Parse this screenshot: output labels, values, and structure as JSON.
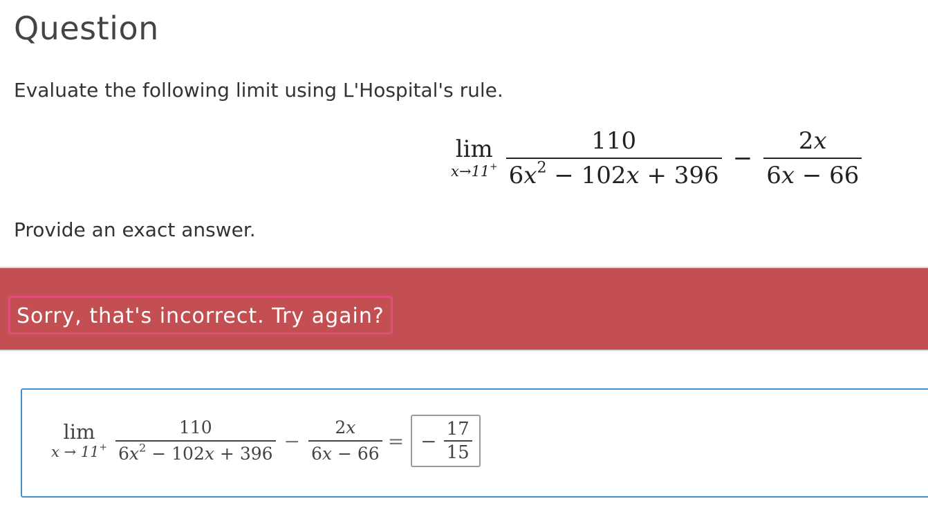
{
  "heading": "Question",
  "instructions": "Evaluate the following limit using L'Hospital's rule.",
  "formula": {
    "lim": "lim",
    "limit_sub": "x→11",
    "limit_sup": "+",
    "frac1_num": "110",
    "frac1_den": {
      "coef": "6",
      "var": "x",
      "exp": "2",
      "rest": " − 102",
      "var2": "x",
      "tail": " + 396"
    },
    "minus": "−",
    "frac2_num": {
      "coef": "2",
      "var": "x"
    },
    "frac2_den": {
      "coef": "6",
      "var": "x",
      "tail": " − 66"
    }
  },
  "note": "Provide an exact answer.",
  "feedback": {
    "message": "Sorry, that's incorrect. Try again?",
    "background": "#c44f52"
  },
  "answer_area": {
    "lim": "lim",
    "limit_sub": "x → 11",
    "limit_sup": "+",
    "frac1_num": "110",
    "frac1_den": {
      "coef": "6",
      "var": "x",
      "exp": "2",
      "rest": " − 102",
      "var2": "x",
      "tail": " + 396"
    },
    "minus": "−",
    "frac2_num": {
      "coef": "2",
      "var": "x"
    },
    "frac2_den": {
      "coef": "6",
      "var": "x",
      "tail": " − 66"
    },
    "equals": "=",
    "input": {
      "sign": "−",
      "numerator": "17",
      "denominator": "15"
    }
  },
  "colors": {
    "accent": "#3f8fd2",
    "error": "#c44f52",
    "highlight": "#e04d7a"
  }
}
